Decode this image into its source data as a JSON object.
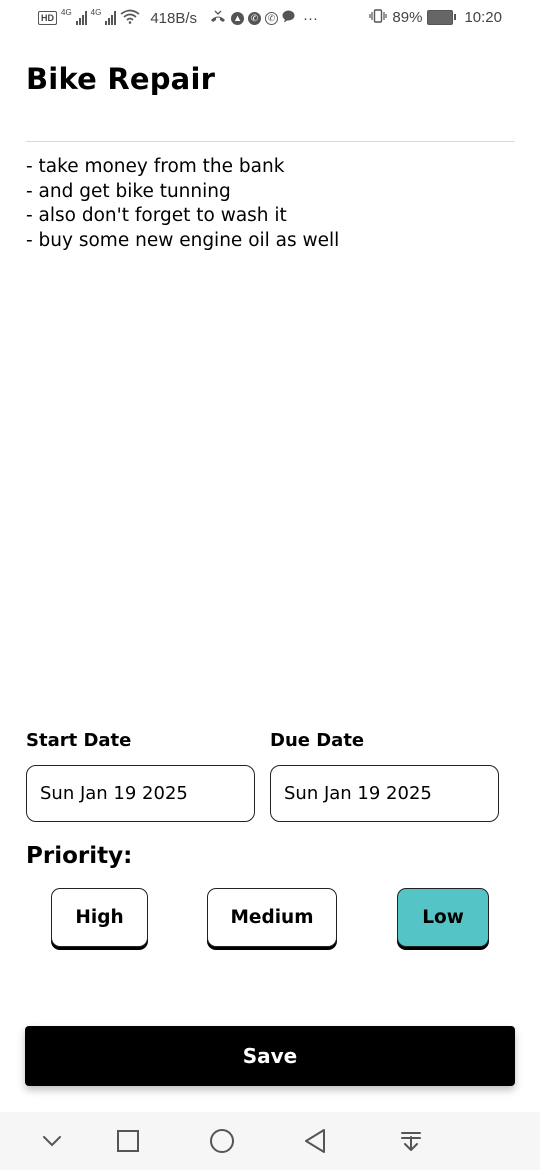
{
  "status_bar": {
    "hd": "HD",
    "signal1_tag": "4G",
    "signal2_tag": "4G",
    "net_speed": "418B/s",
    "more": "···",
    "battery_percent": "89%",
    "time": "10:20"
  },
  "note": {
    "title": "Bike Repair",
    "lines": [
      "- take money from the bank",
      "- and get bike tunning",
      "- also don't forget to wash it",
      "- buy some new engine oil as well"
    ]
  },
  "dates": {
    "start_label": "Start Date",
    "start_value": "Sun Jan 19 2025",
    "due_label": "Due Date",
    "due_value": "Sun Jan 19 2025"
  },
  "priority": {
    "label": "Priority:",
    "options": [
      "High",
      "Medium",
      "Low"
    ],
    "selected": "Low",
    "selected_color": "#55c4c6"
  },
  "actions": {
    "save_label": "Save"
  },
  "nav_bar": {
    "icons": [
      "chevron-down-icon",
      "square-icon",
      "circle-icon",
      "triangle-back-icon",
      "download-arrow-icon"
    ]
  }
}
